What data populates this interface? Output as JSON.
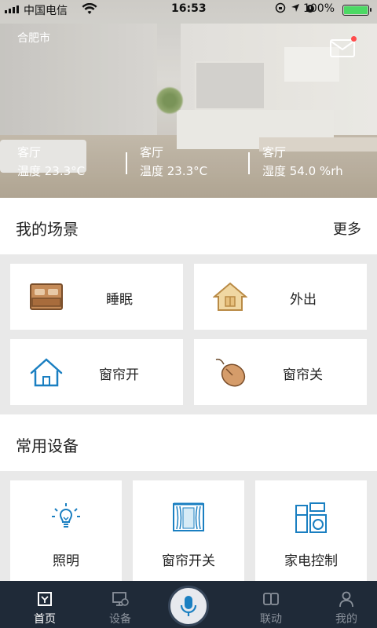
{
  "status": {
    "carrier": "中国电信",
    "time": "16:53",
    "battery": "100%"
  },
  "header": {
    "city": "合肥市"
  },
  "rooms": [
    {
      "name": "客厅",
      "reading": "温度 23.3°C"
    },
    {
      "name": "客厅",
      "reading": "温度 23.3°C"
    },
    {
      "name": "客厅",
      "reading": "湿度 54.0 %rh"
    }
  ],
  "scenes": {
    "title": "我的场景",
    "more": "更多",
    "items": [
      {
        "label": "睡眠",
        "icon": "bed-icon"
      },
      {
        "label": "外出",
        "icon": "house-outline-icon"
      },
      {
        "label": "窗帘开",
        "icon": "home-icon"
      },
      {
        "label": "窗帘关",
        "icon": "mouse-icon"
      }
    ]
  },
  "devices": {
    "title": "常用设备",
    "items": [
      {
        "label": "照明",
        "icon": "bulb-icon"
      },
      {
        "label": "窗帘开关",
        "icon": "curtain-icon"
      },
      {
        "label": "家电控制",
        "icon": "appliance-icon"
      }
    ]
  },
  "tabs": [
    {
      "label": "首页",
      "icon": "home-tab-icon",
      "active": true
    },
    {
      "label": "设备",
      "icon": "device-tab-icon",
      "active": false
    },
    {
      "label": "联动",
      "icon": "link-tab-icon",
      "active": false
    },
    {
      "label": "我的",
      "icon": "person-tab-icon",
      "active": false
    }
  ],
  "colors": {
    "accent_blue": "#1a7fc1",
    "brown": "#b97d4b",
    "tan": "#e8c58c",
    "tabbar": "#1f2a38"
  }
}
